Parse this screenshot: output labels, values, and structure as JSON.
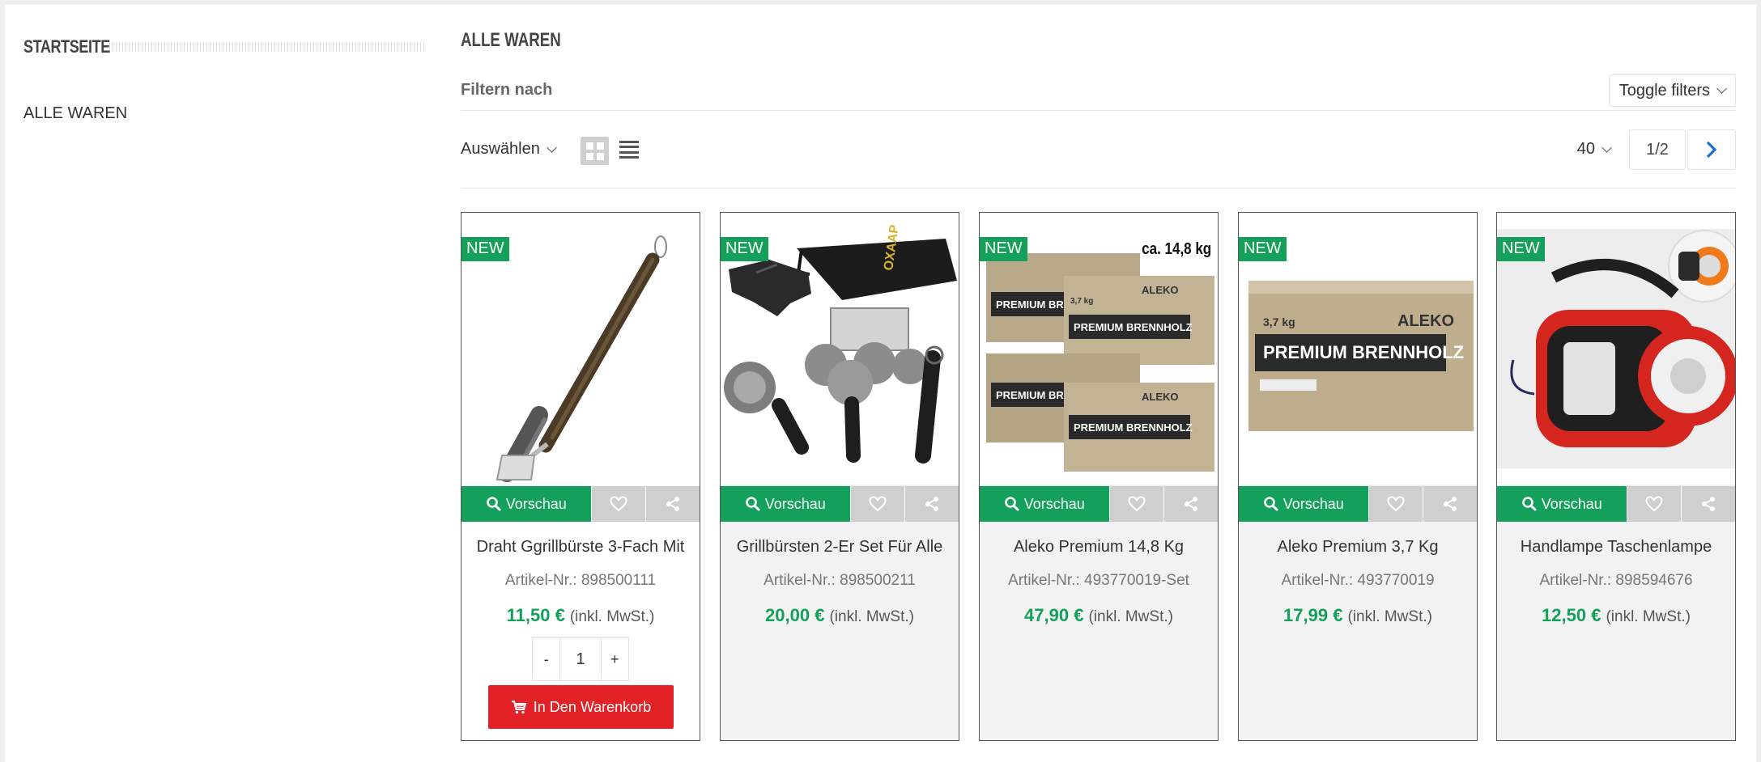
{
  "sidebar": {
    "title": "STARTSEITE",
    "link": "ALLE WAREN"
  },
  "main": {
    "title": "ALLE WAREN",
    "filter_label": "Filtern nach",
    "toggle_filters": "Toggle filters",
    "sort_label": "Auswählen",
    "per_page": "40",
    "page_indicator": "1/2"
  },
  "products": [
    {
      "badge": "NEW",
      "preview": "Vorschau",
      "title": "Draht Ggrillbürste 3-Fach Mit",
      "sku": "Artikel-Nr.: 898500111",
      "price": "11,50 €",
      "tax": "(inkl. MwSt.)",
      "qty_minus": "-",
      "qty": "1",
      "qty_plus": "+",
      "cart": "In Den Warenkorb"
    },
    {
      "badge": "NEW",
      "preview": "Vorschau",
      "title": "Grillbürsten 2-Er Set Für Alle",
      "sku": "Artikel-Nr.: 898500211",
      "price": "20,00 €",
      "tax": "(inkl. MwSt.)"
    },
    {
      "badge": "NEW",
      "preview": "Vorschau",
      "title": "Aleko Premium 14,8 Kg",
      "sku": "Artikel-Nr.: 493770019-Set",
      "price": "47,90 €",
      "tax": "(inkl. MwSt.)",
      "weight": "ca. 14,8 kg",
      "img_text_1": "PREMIUM BRENNHOLZ",
      "img_text_2": "ALEKO",
      "img_text_3": "3,7 kg"
    },
    {
      "badge": "NEW",
      "preview": "Vorschau",
      "title": "Aleko Premium 3,7 Kg",
      "sku": "Artikel-Nr.: 493770019",
      "price": "17,99 €",
      "tax": "(inkl. MwSt.)",
      "img_text_1": "PREMIUM BRENNHOLZ",
      "img_text_2": "ALEKO",
      "img_text_3": "3,7 kg"
    },
    {
      "badge": "NEW",
      "preview": "Vorschau",
      "title": "Handlampe Taschenlampe",
      "sku": "Artikel-Nr.: 898594676",
      "price": "12,50 €",
      "tax": "(inkl. MwSt.)"
    }
  ],
  "bag_logo_text": "OXAAP",
  "colors": {
    "green": "#14a05a",
    "red": "#e32228",
    "grey_button": "#cfcfcf",
    "link_blue": "#1a6fd0"
  }
}
